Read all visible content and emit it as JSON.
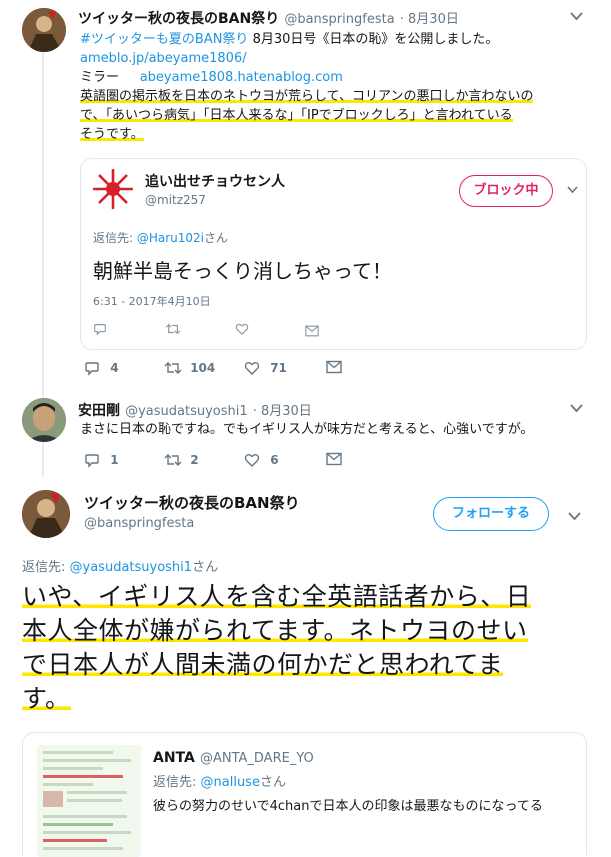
{
  "tweet1": {
    "name": "ツイッター秋の夜長のBAN祭り",
    "handle": "@banspringfesta",
    "date": "· 8月30日",
    "line1_tag": "#ツイッターも夏のBAN祭り",
    "line1_text": " 8月30日号《日本の恥》を公開しました。",
    "line2_link": "ameblo.jp/abeyame1806/",
    "line3_label": "ミラー",
    "line3_link": "abeyame1808.hatenablog.com",
    "line4": "英語圏の掲示板を日本のネトウヨが荒らして、コリアンの悪口しか言わないの",
    "line5": "で、「あいつら病気」「日本人来るな」「IPでブロックしろ」と言われている",
    "line6": "そうです。",
    "actions": {
      "reply": "4",
      "retweet": "104",
      "like": "71"
    }
  },
  "quoted1": {
    "name": "追い出せチョウセン人",
    "handle": "@mitz257",
    "block_label": "ブロック中",
    "reply_to_label": "返信先: ",
    "reply_to_handle": "@Haru102i",
    "reply_to_suffix": "さん",
    "text": "朝鮮半島そっくり消しちゃって！",
    "timestamp": "6:31 - 2017年4月10日"
  },
  "tweet2": {
    "name": "安田剛",
    "handle": "@yasudatsuyoshi1",
    "date": "· 8月30日",
    "text": "まさに日本の恥ですね。でもイギリス人が味方だと考えると、心強いですが。",
    "actions": {
      "reply": "1",
      "retweet": "2",
      "like": "6"
    }
  },
  "tweet3": {
    "name": "ツイッター秋の夜長のBAN祭り",
    "handle": "@banspringfesta",
    "follow_label": "フォローする",
    "reply_to_label": "返信先: ",
    "reply_to_handle": "@yasudatsuyoshi1",
    "reply_to_suffix": "さん",
    "line1": "いや、イギリス人を含む全英語話者から、日",
    "line2": "本人全体が嫌がられてます。ネトウヨのせい",
    "line3": "で日本人が人間未満の何かだと思われてま",
    "line4": "す。"
  },
  "quoted2": {
    "name": "ANTA",
    "handle": "@ANTA_DARE_YO",
    "reply_to_label": "返信先: ",
    "reply_to_handle": "@nalluse",
    "reply_to_suffix": "さん",
    "text": "彼らの努力のせいで4chanで日本人の印象は最悪なものになってる"
  },
  "icons": [
    "chevron-down-icon",
    "reply-icon",
    "retweet-icon",
    "like-icon",
    "dm-icon"
  ],
  "colors": {
    "link": "#1b95e0",
    "highlight": "#ffe600",
    "block": "#e0245e",
    "muted": "#657786"
  }
}
